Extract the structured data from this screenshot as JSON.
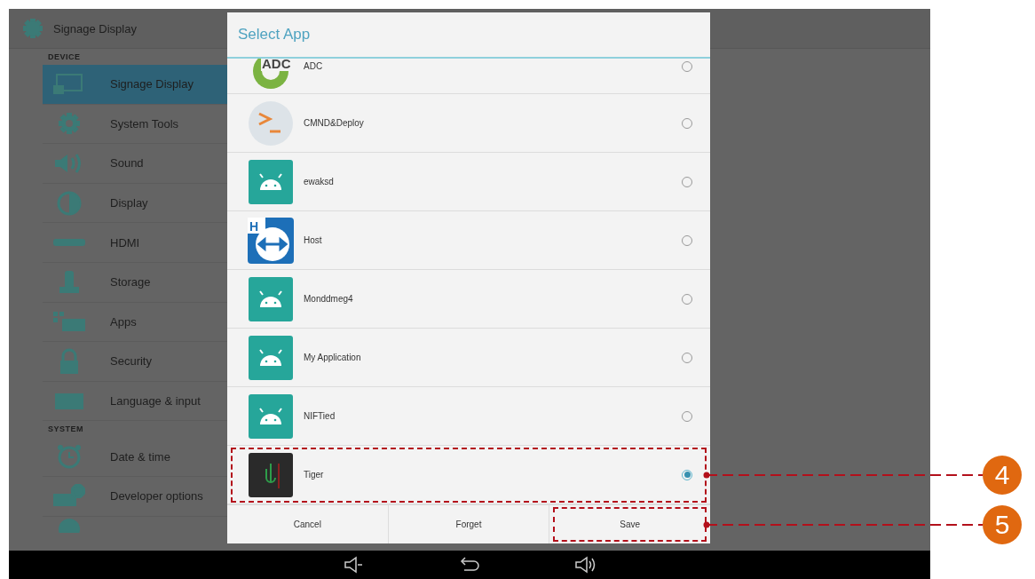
{
  "settings": {
    "title": "Signage Display",
    "sections": [
      {
        "heading": "DEVICE",
        "items": [
          {
            "label": "Signage Display",
            "kind": "signage",
            "selected": true
          },
          {
            "label": "System Tools",
            "kind": "gear",
            "selected": false
          },
          {
            "label": "Sound",
            "kind": "sound",
            "selected": false
          },
          {
            "label": "Display",
            "kind": "display",
            "selected": false
          },
          {
            "label": "HDMI",
            "kind": "hdmi",
            "selected": false
          },
          {
            "label": "Storage",
            "kind": "storage",
            "selected": false
          },
          {
            "label": "Apps",
            "kind": "apps",
            "selected": false
          },
          {
            "label": "Security",
            "kind": "lock",
            "selected": false
          },
          {
            "label": "Language & input",
            "kind": "keyboard",
            "selected": false
          }
        ]
      },
      {
        "heading": "SYSTEM",
        "items": [
          {
            "label": "Date & time",
            "kind": "clock",
            "selected": false
          },
          {
            "label": "Developer options",
            "kind": "dev",
            "selected": false
          },
          {
            "kind": "partial",
            "selected": false
          }
        ]
      }
    ]
  },
  "dialog": {
    "title": "Select App",
    "apps": [
      {
        "name": "ADC",
        "kind": "adc",
        "logo_text": "ADC",
        "selected": false
      },
      {
        "name": "CMND&Deploy",
        "kind": "terminal",
        "selected": false
      },
      {
        "name": "ewaksd",
        "kind": "android",
        "selected": false
      },
      {
        "name": "Host",
        "kind": "remote",
        "logo_text": "H",
        "selected": false
      },
      {
        "name": "Monddmeg4",
        "kind": "android",
        "selected": false
      },
      {
        "name": "My Application",
        "kind": "android",
        "selected": false
      },
      {
        "name": "NIFTied",
        "kind": "android",
        "selected": false
      },
      {
        "name": "Tiger",
        "kind": "dark",
        "selected": true,
        "callout": "4"
      }
    ],
    "buttons": [
      {
        "label": "Cancel"
      },
      {
        "label": "Forget"
      },
      {
        "label": "Save",
        "callout": "5"
      }
    ]
  }
}
